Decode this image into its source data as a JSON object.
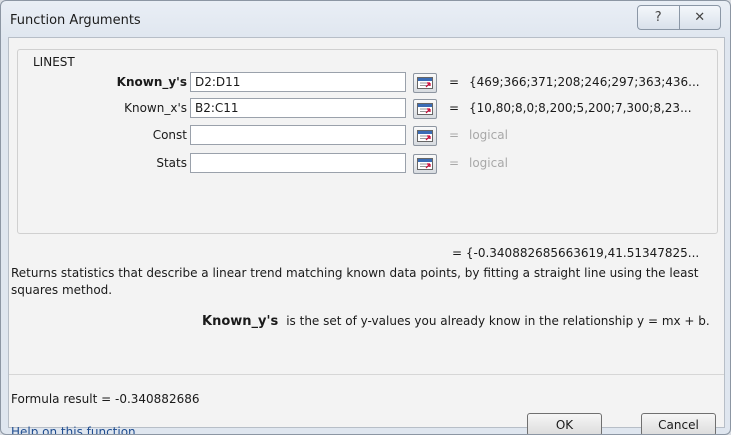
{
  "window": {
    "title": "Function Arguments"
  },
  "titlebar_buttons": {
    "help_glyph": "?",
    "close_glyph": "✕"
  },
  "function": {
    "name": "LINEST",
    "args": [
      {
        "label": "Known_y's",
        "bold": true,
        "value": "D2:D11",
        "eval": "{469;366;371;208;246;297;363;436...",
        "placeholder": false
      },
      {
        "label": "Known_x's",
        "bold": false,
        "value": "B2:C11",
        "eval": "{10,80;8,0;8,200;5,200;7,300;8,23...",
        "placeholder": false
      },
      {
        "label": "Const",
        "bold": false,
        "value": "",
        "eval": "logical",
        "placeholder": true
      },
      {
        "label": "Stats",
        "bold": false,
        "value": "",
        "eval": "logical",
        "placeholder": true
      }
    ],
    "result_preview": "{-0.340882685663619,41.51347825...",
    "description": "Returns statistics that describe a linear trend matching known data points, by fitting a straight line using the least squares method.",
    "arg_description": {
      "arg": "Known_y's",
      "text": "is the set of y-values you already know in the relationship y = mx + b."
    }
  },
  "formula_result": {
    "label": "Formula result =",
    "value": "-0.340882686"
  },
  "help_link": "Help on this function",
  "buttons": {
    "ok": "OK",
    "cancel": "Cancel"
  },
  "colors": {
    "link": "#1e4c8f",
    "placeholder_gray": "#a8a8a8",
    "title_bg": "#dfe6ef"
  },
  "icons": {
    "refedit": "collapse-dialog-icon",
    "help": "help-icon",
    "close": "close-icon"
  }
}
